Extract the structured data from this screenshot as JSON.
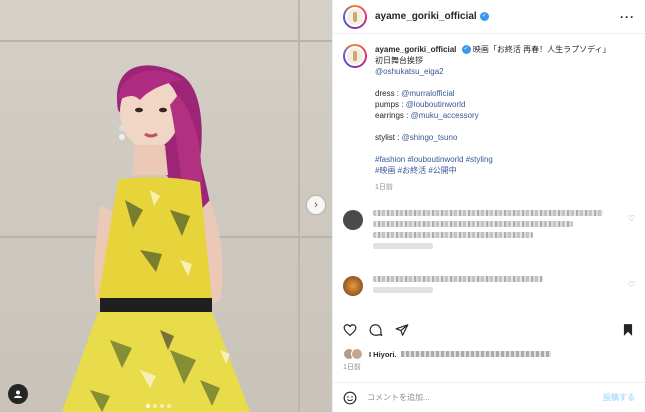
{
  "post": {
    "username": "ayame_goriki_official",
    "more_icon": "more-horizontal-icon",
    "caption": {
      "line1": "映画「お終活 再春！人生ラプソディ」",
      "line2": "初日舞台挨拶",
      "mention_film": "@oshukatsu_eiga2",
      "dress_label": "dress : ",
      "dress_link": "@murralofficial",
      "pumps_label": "pumps : ",
      "pumps_link": "@louboutinworld",
      "earrings_label": "earrings : ",
      "earrings_link": "@muku_accessory",
      "stylist_label": "stylist : ",
      "stylist_link": "@shingo_tsuno",
      "hashtags1": "#fashion #louboutinworld #styling",
      "hashtags2": "#映画 #お終活 #公開中"
    },
    "time_ago": "1日前",
    "likes_time": "1日前",
    "likes_lead": "I Hiyori.",
    "comment_placeholder": "コメントを追加...",
    "post_button": "投稿する"
  },
  "colors": {
    "link": "#385898",
    "verified": "#3897f0",
    "hair": "#a8287a",
    "dress_yellow": "#e6d43a"
  },
  "icons": [
    "heart-icon",
    "comment-icon",
    "share-icon",
    "bookmark-icon",
    "emoji-icon",
    "user-tag-icon",
    "next-arrow-icon"
  ]
}
